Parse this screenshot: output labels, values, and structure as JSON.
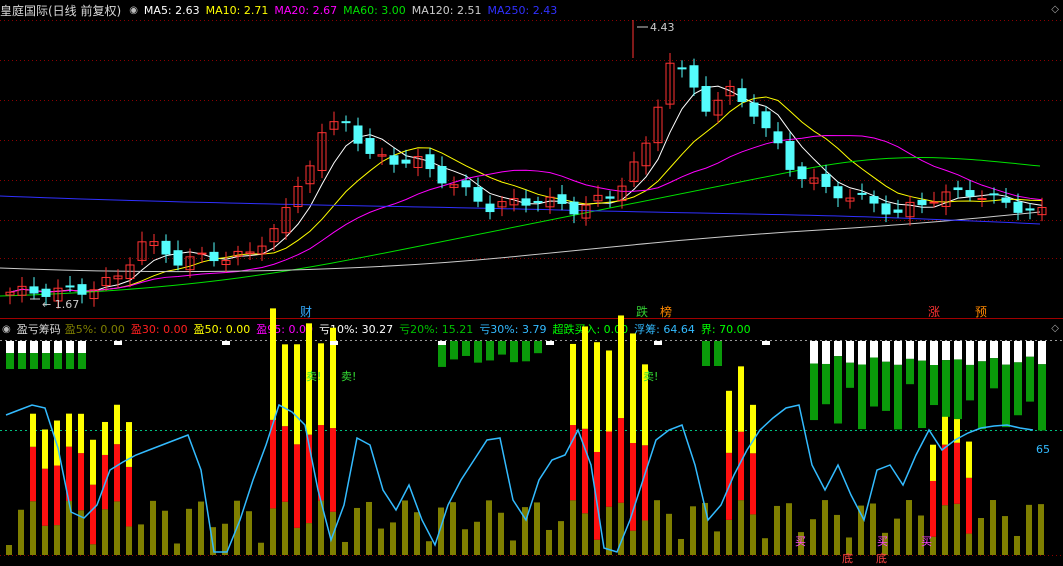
{
  "stock_title": "皇庭国际(日线 前复权)",
  "ma_legend": [
    {
      "label": "MA5: 2.63",
      "color": "#ffffff"
    },
    {
      "label": "MA10: 2.71",
      "color": "#ffff00"
    },
    {
      "label": "MA20: 2.67",
      "color": "#ff00ff"
    },
    {
      "label": "MA60: 3.00",
      "color": "#00e000"
    },
    {
      "label": "MA120: 2.51",
      "color": "#cccccc"
    },
    {
      "label": "MA250: 2.43",
      "color": "#3030ff"
    }
  ],
  "indicator_title": "盈亏筹码",
  "indicator_legend": [
    {
      "label": "盈5%: 0.00",
      "color": "#7f7f00"
    },
    {
      "label": "盈30: 0.00",
      "color": "#ff2020"
    },
    {
      "label": "盈50: 0.00",
      "color": "#ffff00"
    },
    {
      "label": "盈95: 0.00",
      "color": "#ff00ff"
    },
    {
      "label": "亏10%: 30.27",
      "color": "#ffffff"
    },
    {
      "label": "亏20%: 15.21",
      "color": "#00c000"
    },
    {
      "label": "亏30%: 3.79",
      "color": "#33bbff"
    },
    {
      "label": "超跌买入: 0.00",
      "color": "#00ff00"
    },
    {
      "label": "浮筹: 64.64",
      "color": "#33bbff"
    },
    {
      "label": "界: 70.00",
      "color": "#00ff00"
    }
  ],
  "price_annotations": {
    "high": "4.43",
    "low": "1.67"
  },
  "event_markers": [
    {
      "text": "财",
      "color": "#33aaff"
    },
    {
      "text": "跌",
      "color": "#33cc33"
    },
    {
      "text": "榜",
      "color": "#ff8800"
    },
    {
      "text": "涨",
      "color": "#ff3333"
    },
    {
      "text": "预",
      "color": "#ff8800"
    }
  ],
  "signals": {
    "sell": "卖!",
    "buy": "买",
    "bottom": "底"
  },
  "last_float_value": "65",
  "colors": {
    "up": "#ff3232",
    "down": "#54fcfc",
    "grid": "#8b0000",
    "separator": "#a00000"
  },
  "chart_data": {
    "type": "candlestick+indicator",
    "ma_values": {
      "MA5": 2.63,
      "MA10": 2.71,
      "MA20": 2.67,
      "MA60": 3.0,
      "MA120": 2.51,
      "MA250": 2.43
    },
    "price_high": 4.43,
    "price_low": 1.67,
    "indicator_values": {
      "盈5%": 0.0,
      "盈30": 0.0,
      "盈50": 0.0,
      "盈95": 0.0,
      "亏10%": 30.27,
      "亏20%": 15.21,
      "亏30%": 3.79,
      "超跌买入": 0.0,
      "浮筹": 64.64,
      "界": 70.0
    }
  }
}
